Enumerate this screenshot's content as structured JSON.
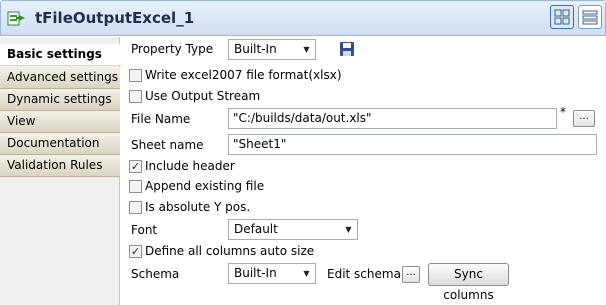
{
  "window": {
    "title": "tFileOutputExcel_1"
  },
  "sidebar": {
    "items": [
      {
        "label": "Basic settings"
      },
      {
        "label": "Advanced settings"
      },
      {
        "label": "Dynamic settings"
      },
      {
        "label": "View"
      },
      {
        "label": "Documentation"
      },
      {
        "label": "Validation Rules"
      }
    ]
  },
  "form": {
    "property_type": {
      "label": "Property Type",
      "value": "Built-In"
    },
    "write_excel2007": {
      "label": "Write excel2007 file format(xlsx)",
      "checked": false
    },
    "use_output_stream": {
      "label": "Use Output Stream",
      "checked": false
    },
    "file_name": {
      "label": "File Name",
      "value": "\"C:/builds/data/out.xls\"",
      "required_marker": "*",
      "browse_label": "..."
    },
    "sheet_name": {
      "label": "Sheet name",
      "value": "\"Sheet1\""
    },
    "include_header": {
      "label": "Include header",
      "checked": true
    },
    "append_existing": {
      "label": "Append existing file",
      "checked": false
    },
    "absolute_y": {
      "label": "Is absolute Y pos.",
      "checked": false
    },
    "font": {
      "label": "Font",
      "value": "Default"
    },
    "auto_size": {
      "label": "Define all columns auto size",
      "checked": true
    },
    "schema": {
      "label": "Schema",
      "value": "Built-In",
      "edit_label": "Edit schema",
      "edit_button": "...",
      "sync_button": "Sync columns"
    }
  },
  "check_glyph": "✓",
  "colors": {
    "titlebar": "#cfdff2",
    "nav_inactive": "#d9d4c1",
    "nav_selected": "#ffffff"
  }
}
